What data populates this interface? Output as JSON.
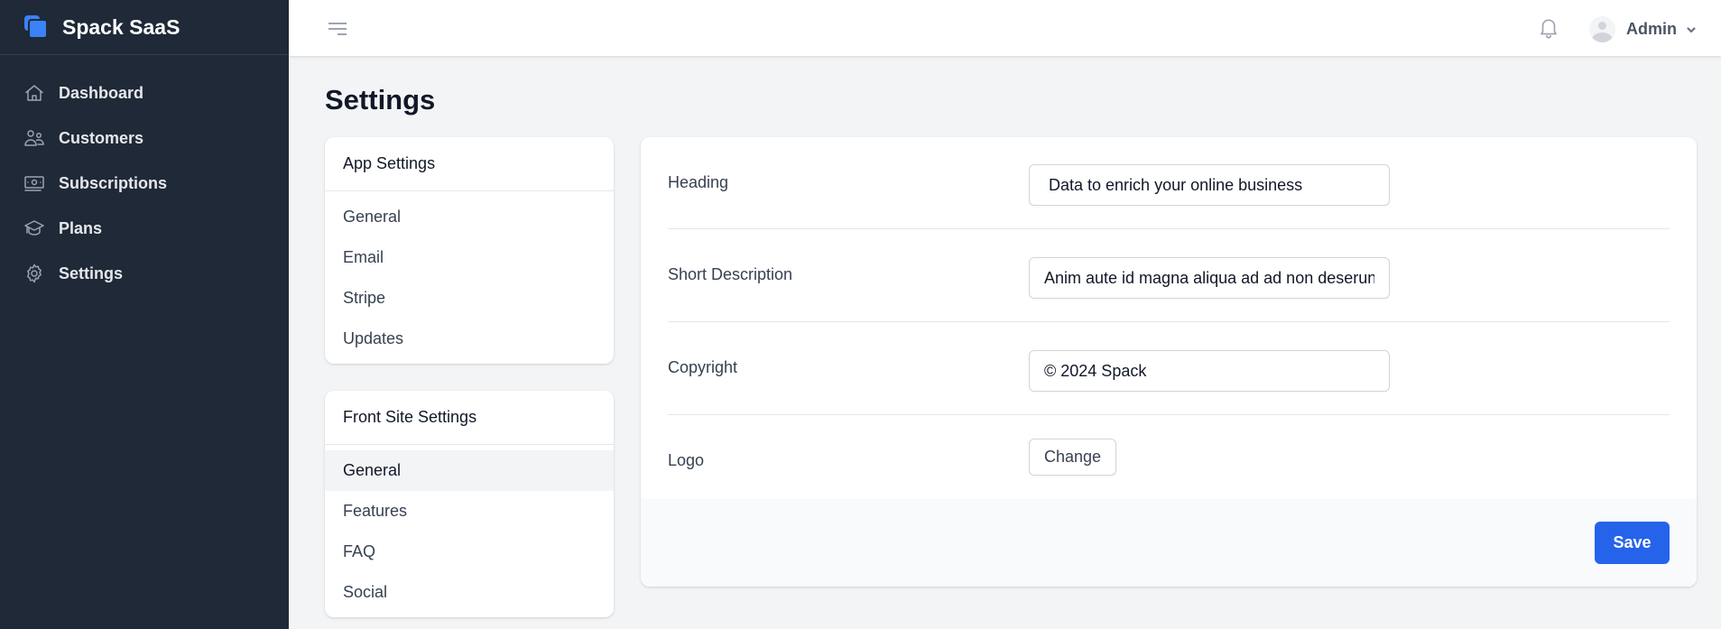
{
  "app": {
    "name": "Spack SaaS",
    "accent_color": "#3b82f6",
    "sidebar_bg": "#1f2937"
  },
  "sidebar": {
    "items": [
      {
        "label": "Dashboard",
        "icon": "home-icon"
      },
      {
        "label": "Customers",
        "icon": "users-icon"
      },
      {
        "label": "Subscriptions",
        "icon": "banknotes-icon"
      },
      {
        "label": "Plans",
        "icon": "academic-cap-icon"
      },
      {
        "label": "Settings",
        "icon": "gear-icon"
      }
    ]
  },
  "header": {
    "menu_icon": "menu-icon",
    "notification_icon": "bell-icon",
    "user_name": "Admin"
  },
  "page": {
    "title": "Settings"
  },
  "settings_menu": {
    "app_settings": {
      "title": "App Settings",
      "items": [
        "General",
        "Email",
        "Stripe",
        "Updates"
      ]
    },
    "front_site_settings": {
      "title": "Front Site Settings",
      "items": [
        "General",
        "Features",
        "FAQ",
        "Social"
      ],
      "active": "General"
    }
  },
  "form": {
    "heading": {
      "label": "Heading",
      "value": " Data to enrich your online business"
    },
    "short_description": {
      "label": "Short Description",
      "value": "Anim aute id magna aliqua ad ad non deserunt sunt."
    },
    "copyright": {
      "label": "Copyright",
      "value": "© 2024 Spack"
    },
    "logo": {
      "label": "Logo",
      "button_label": "Change"
    },
    "save_label": "Save",
    "save_color": "#2563eb"
  }
}
